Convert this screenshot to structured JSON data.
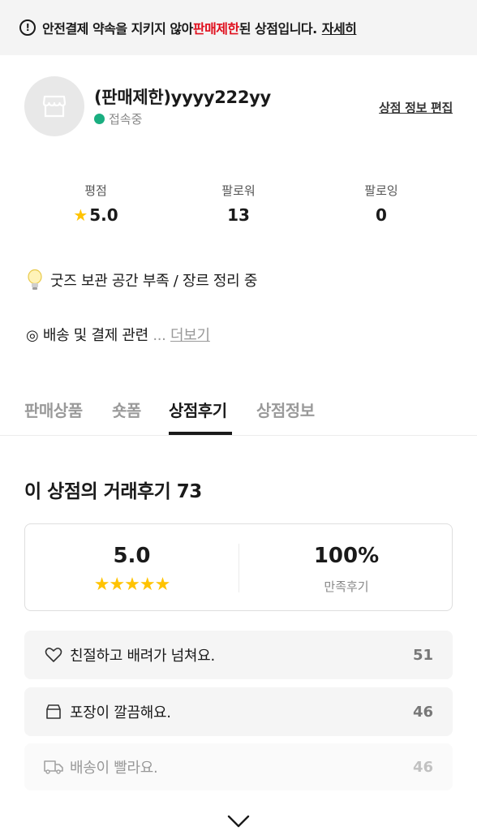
{
  "banner": {
    "prefix": "안전결제 약속을 지키지 않아 ",
    "highlight": "판매제한",
    "suffix": "된 상점입니다.",
    "link": "자세히"
  },
  "profile": {
    "name": "(판매제한)yyyy222yy",
    "status": "접속중",
    "edit_link": "상점 정보 편집"
  },
  "stats": [
    {
      "label": "평점",
      "value": "5.0"
    },
    {
      "label": "팔로워",
      "value": "13"
    },
    {
      "label": "팔로잉",
      "value": "0"
    }
  ],
  "description": {
    "line1": "굿즈 보관 공간 부족 / 장르 정리 중",
    "line2": "◎ 배송 및 결제 관련",
    "ellipsis": " ... ",
    "more": "더보기"
  },
  "tabs": [
    {
      "label": "판매상품",
      "active": false
    },
    {
      "label": "숏폼",
      "active": false
    },
    {
      "label": "상점후기",
      "active": true
    },
    {
      "label": "상점정보",
      "active": false
    }
  ],
  "reviews": {
    "title": "이 상점의 거래후기 73",
    "score": "5.0",
    "stars": "★★★★★",
    "rating": 5,
    "satisfaction_pct": "100%",
    "satisfaction_label": "만족후기",
    "keywords": [
      {
        "icon": "heart-icon",
        "text": "친절하고 배려가 넘쳐요.",
        "count": "51"
      },
      {
        "icon": "box-icon",
        "text": "포장이 깔끔해요.",
        "count": "46"
      },
      {
        "icon": "truck-icon",
        "text": "배송이 빨라요.",
        "count": "46"
      }
    ]
  },
  "colors": {
    "highlight_red": "#e0101e",
    "online_green": "#1aae80",
    "star_yellow": "#ffc300"
  }
}
